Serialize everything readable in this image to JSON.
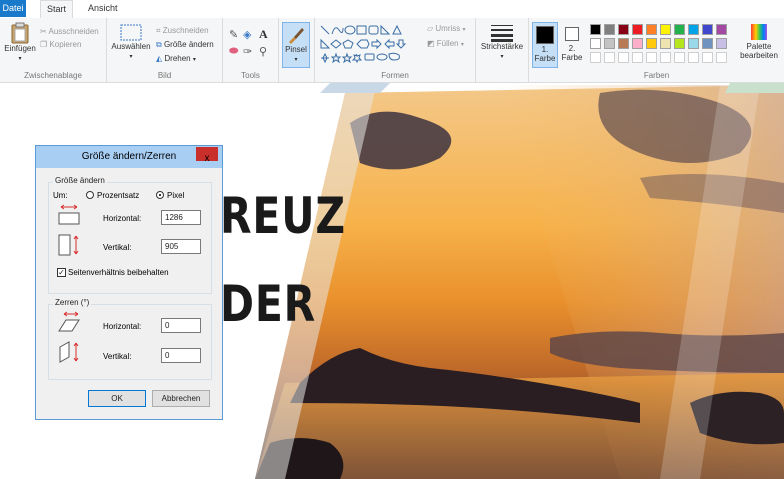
{
  "tabs": {
    "file": "Datei",
    "start": "Start",
    "view": "Ansicht"
  },
  "clipboard": {
    "paste": "Einfügen",
    "cut": "Ausschneiden",
    "copy": "Kopieren",
    "label": "Zwischenablage"
  },
  "image": {
    "select": "Auswählen",
    "crop": "Zuschneiden",
    "resize": "Größe ändern",
    "rotate": "Drehen",
    "label": "Bild"
  },
  "tools": {
    "label": "Tools"
  },
  "brushes": {
    "label": "Pinsel"
  },
  "shapes": {
    "outline": "Umriss",
    "fill": "Füllen",
    "label": "Formen"
  },
  "size": {
    "label": "Strichstärke"
  },
  "colors": {
    "color1_label": "1. Farbe",
    "color2_label": "2. Farbe",
    "edit_palette": "Palette bearbeiten",
    "label": "Farben",
    "color1": "#000000",
    "color2": "#ffffff",
    "palette_row1": [
      "#000000",
      "#7f7f7f",
      "#880015",
      "#ed1c24",
      "#ff7f27",
      "#fff200",
      "#22b14c",
      "#00a2e8",
      "#3f48cc",
      "#a349a4"
    ],
    "palette_row2": [
      "#ffffff",
      "#c3c3c3",
      "#b97a57",
      "#ffaec9",
      "#ffc90e",
      "#efe4b0",
      "#b5e61d",
      "#99d9ea",
      "#7092be",
      "#c8bfe7"
    ]
  },
  "canvas_text": {
    "line1": "REUZ",
    "line2": "DER"
  },
  "dialog": {
    "title": "Größe ändern/Zerren",
    "close": "x",
    "resize_legend": "Größe ändern",
    "by_label": "Um:",
    "percent_label": "Prozentsatz",
    "pixel_label": "Pixel",
    "horizontal_label": "Horizontal:",
    "vertical_label": "Vertikal:",
    "resize_h": "1286",
    "resize_v": "905",
    "keep_ratio": "Seitenverhältnis beibehalten",
    "skew_legend": "Zerren (°)",
    "skew_h_label": "Horizontal:",
    "skew_v_label": "Vertikal:",
    "skew_h": "0",
    "skew_v": "0",
    "ok": "OK",
    "cancel": "Abbrechen"
  }
}
